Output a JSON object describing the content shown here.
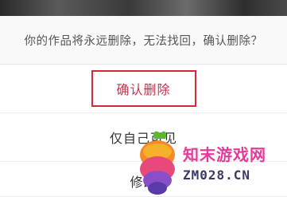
{
  "dialog": {
    "warning": "你的作品将永远删除，无法找回，确认删除？",
    "confirm_label": "确认删除",
    "private_label": "仅自己可见",
    "edit_label": "修改"
  },
  "watermark": {
    "brand": "知末游戏网",
    "domain": "ZM028.CN"
  }
}
